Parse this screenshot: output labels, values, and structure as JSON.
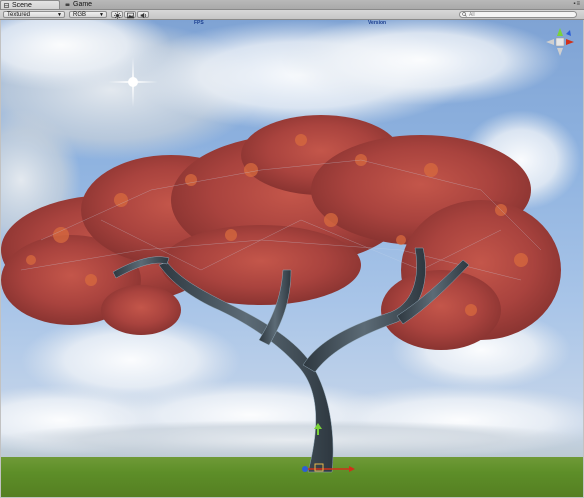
{
  "tabs": [
    {
      "label": "Scene",
      "icon": "scene-icon",
      "active": true
    },
    {
      "label": "Game",
      "icon": "game-icon",
      "active": false
    }
  ],
  "toolbar": {
    "render_mode": "Textured",
    "color_mode": "RGB",
    "buttons": [
      "lighting-icon",
      "image-effects-icon",
      "audio-icon"
    ],
    "search_placeholder": "All"
  },
  "viewport": {
    "fps_label": "FPS",
    "version_label": "Version",
    "orientation_gizmo": "axis-gizmo-icon"
  },
  "colors": {
    "sky": "#8fb3e0",
    "leaves": "#b24a42",
    "trunk": "#4e5c67",
    "ground": "#5d8e28",
    "stat_text": "#1c3f8f"
  }
}
